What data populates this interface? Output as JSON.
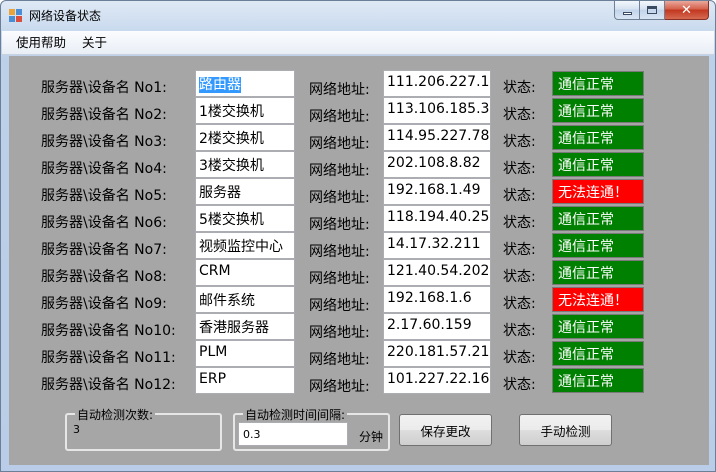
{
  "window": {
    "title": "网络设备状态"
  },
  "menu": [
    "使用帮助",
    "关于"
  ],
  "labels": {
    "address": "网络地址:",
    "state": "状态:"
  },
  "devices": [
    {
      "label": "服务器\\设备名 No1:",
      "name": "路由器",
      "ip": "111.206.227.118",
      "status": "通信正常",
      "ok": true
    },
    {
      "label": "服务器\\设备名 No2:",
      "name": "1楼交换机",
      "ip": "113.106.185.30",
      "status": "通信正常",
      "ok": true
    },
    {
      "label": "服务器\\设备名 No3:",
      "name": "2楼交换机",
      "ip": "114.95.227.78",
      "status": "通信正常",
      "ok": true
    },
    {
      "label": "服务器\\设备名 No4:",
      "name": "3楼交换机",
      "ip": "202.108.8.82",
      "status": "通信正常",
      "ok": true
    },
    {
      "label": "服务器\\设备名 No5:",
      "name": "服务器",
      "ip": "192.168.1.49",
      "status": "无法连通！",
      "ok": false
    },
    {
      "label": "服务器\\设备名 No6:",
      "name": "5楼交换机",
      "ip": "118.194.40.25",
      "status": "通信正常",
      "ok": true
    },
    {
      "label": "服务器\\设备名 No7:",
      "name": "视频监控中心",
      "ip": "14.17.32.211",
      "status": "通信正常",
      "ok": true
    },
    {
      "label": "服务器\\设备名 No8:",
      "name": "CRM",
      "ip": "121.40.54.202",
      "status": "通信正常",
      "ok": true
    },
    {
      "label": "服务器\\设备名 No9:",
      "name": "邮件系统",
      "ip": "192.168.1.6",
      "status": "无法连通！",
      "ok": false
    },
    {
      "label": "服务器\\设备名 No10:",
      "name": "香港服务器",
      "ip": "2.17.60.159",
      "status": "通信正常",
      "ok": true
    },
    {
      "label": "服务器\\设备名 No11:",
      "name": "PLM",
      "ip": "220.181.57.217",
      "status": "通信正常",
      "ok": true
    },
    {
      "label": "服务器\\设备名 No12:",
      "name": "ERP",
      "ip": "101.227.22.162",
      "status": "通信正常",
      "ok": true
    }
  ],
  "auto_count": {
    "title": "自动检测次数:",
    "value": "3"
  },
  "auto_interval": {
    "title": "自动检测时间间隔:",
    "value": "0.3",
    "unit": "分钟"
  },
  "buttons": {
    "save": "保存更改",
    "manual": "手动检测"
  },
  "colors": {
    "ok": "#008000",
    "fail": "#ff0000",
    "client_bg": "#a6a6a6",
    "selection": "#3399ff"
  },
  "icons": {
    "app": "network-app-icon",
    "minimize": "minimize-icon",
    "maximize": "maximize-icon",
    "close": "close-icon"
  }
}
